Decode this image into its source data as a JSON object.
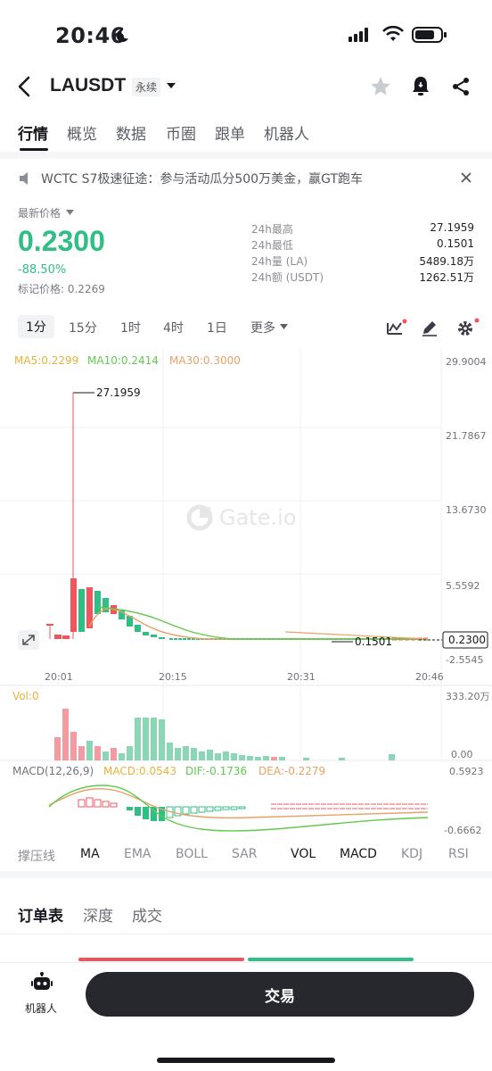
{
  "status_bar": {
    "time": "20:46"
  },
  "header": {
    "pair": "LAUSDT",
    "contract_type": "永续"
  },
  "main_tabs": [
    {
      "label": "行情",
      "active": true
    },
    {
      "label": "概览"
    },
    {
      "label": "数据"
    },
    {
      "label": "币圈"
    },
    {
      "label": "跟单"
    },
    {
      "label": "机器人"
    }
  ],
  "notice": {
    "text": "WCTC S7极速征途：参与活动瓜分500万美金，赢GT跑车"
  },
  "ticker": {
    "latest_label": "最新价格",
    "price": "0.2300",
    "change": "-88.50%",
    "mark_price": "标记价格: 0.2269",
    "stats": [
      {
        "label": "24h最高",
        "value": "27.1959"
      },
      {
        "label": "24h最低",
        "value": "0.1501"
      },
      {
        "label": "24h量 (LA)",
        "value": "5489.18万"
      },
      {
        "label": "24h额 (USDT)",
        "value": "1262.51万"
      }
    ],
    "up_color": "#2fbf84",
    "down_color": "#f0555d"
  },
  "intervals": [
    {
      "label": "1分",
      "active": true
    },
    {
      "label": "15分"
    },
    {
      "label": "1时"
    },
    {
      "label": "4时"
    },
    {
      "label": "1日"
    },
    {
      "label": "更多"
    }
  ],
  "chart": {
    "ma_legend": {
      "ma5": "MA5:0.2299",
      "ma10": "MA10:0.2414",
      "ma30": "MA30:0.3000"
    },
    "watermark": "Gate.io",
    "y_ticks": [
      "29.9004",
      "21.7867",
      "13.6730",
      "5.5592",
      "-2.5545"
    ],
    "x_ticks": [
      "20:01",
      "20:15",
      "20:31",
      "20:46"
    ],
    "high_label": "27.1959",
    "low_label": "0.1501",
    "last_price_label": "0.2300",
    "vol_label": "Vol:0",
    "vol_ticks": [
      "333.20万",
      "0.00"
    ],
    "macd_legend": {
      "params": "MACD(12,26,9)",
      "macd": "MACD:0.0543",
      "dif": "DIF:-0.1736",
      "dea": "DEA:-0.2279"
    },
    "macd_ticks": [
      "0.5923",
      "-0.6662"
    ]
  },
  "indicators": [
    {
      "label": "撑压线"
    },
    {
      "label": "MA",
      "on": true
    },
    {
      "label": "EMA"
    },
    {
      "label": "BOLL"
    },
    {
      "label": "SAR"
    },
    {
      "label": "VOL",
      "on": true
    },
    {
      "label": "MACD",
      "on": true
    },
    {
      "label": "KDJ"
    },
    {
      "label": "RSI"
    }
  ],
  "orderbook_tabs": [
    {
      "label": "订单表",
      "active": true
    },
    {
      "label": "深度"
    },
    {
      "label": "成交"
    }
  ],
  "bottom_bar": {
    "robot_label": "机器人",
    "trade_label": "交易"
  }
}
